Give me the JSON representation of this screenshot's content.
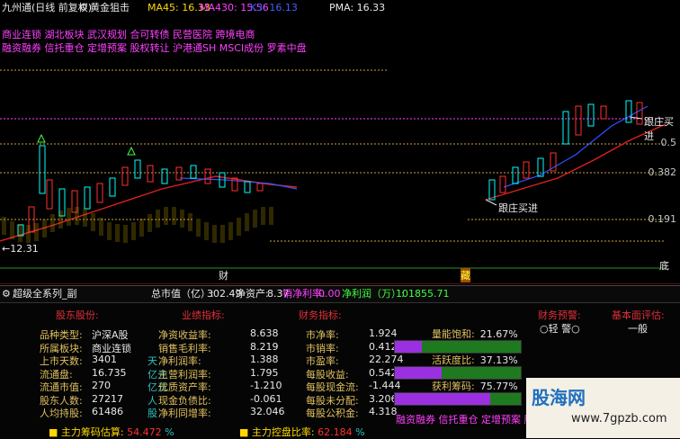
{
  "header": {
    "title": "九州通(日线 前复权)",
    "indicator": "黄金狙击",
    "ma5": "MA45: 16.33",
    "ma30": "MA430: 15.56",
    "ma_extra": "K3: 16.13",
    "pma": "PMA: 16.33"
  },
  "concepts": {
    "line1": "商业连锁 湖北板块 武汉规划 合可转债 民营医院 跨境电商",
    "line2": "融资融券 信托重仓 定增预案 股权转让 沪港通SH MSCI成份 罗素中盘"
  },
  "chart_annotations": {
    "low_price": "←12.31",
    "follow_1": "跟庄买进",
    "follow_2": "跟庄买进",
    "bottom_left_marker": "财",
    "bottom_mid_marker": "藏",
    "bottom_right_marker": "底"
  },
  "right_axis": {
    "r1": "0.5",
    "r2": "0.382",
    "r3": "0.191"
  },
  "sub_header": {
    "name": "超级全系列_副",
    "total_label": "总市值（亿）:",
    "total_value": "302.49",
    "net_asset_label": "净资产:",
    "net_asset_value": "8.37",
    "profit_rate_label": "销净利率:",
    "profit_rate_value": "0.00",
    "net_profit_label": "净利润（万）:",
    "net_profit_value": "101855.71"
  },
  "panel": {
    "col1_title": "股东股份:",
    "col2_title": "业绩指标:",
    "col3_title": "财务指标:",
    "col4_title": "财务预警:",
    "col5_title": "基本面评估:",
    "warning_value": "○轻 警○",
    "eval_value": "一般",
    "col1": [
      {
        "label": "品种类型:",
        "value": "沪深A股",
        "unit": ""
      },
      {
        "label": "所属板块:",
        "value": "商业连锁",
        "unit": ""
      },
      {
        "label": "上市天数:",
        "value": "3401",
        "unit": "天"
      },
      {
        "label": "流通盘:",
        "value": "16.735",
        "unit": "亿元"
      },
      {
        "label": "流通市值:",
        "value": "270",
        "unit": "亿元"
      },
      {
        "label": "股东人数:",
        "value": "27217",
        "unit": "人"
      },
      {
        "label": "人均持股:",
        "value": "61486",
        "unit": "股"
      }
    ],
    "col2": [
      {
        "label": "净资收益率:",
        "value": "8.638"
      },
      {
        "label": "销售毛利率:",
        "value": "8.219"
      },
      {
        "label": "净利润率:",
        "value": "1.388"
      },
      {
        "label": "主营利润率:",
        "value": "1.795"
      },
      {
        "label": "优质资产率:",
        "value": "-1.210"
      },
      {
        "label": "现金负债比:",
        "value": "-0.061"
      },
      {
        "label": "净利同增率:",
        "value": "32.046"
      }
    ],
    "col3": [
      {
        "label": "市净率:",
        "value": "1.924"
      },
      {
        "label": "市销率:",
        "value": "0.412"
      },
      {
        "label": "市盈率:",
        "value": "22.274"
      },
      {
        "label": "每股收益:",
        "value": "0.542"
      },
      {
        "label": "每股现金流:",
        "value": "-1.444"
      },
      {
        "label": "每股未分配:",
        "value": "3.206"
      },
      {
        "label": "每股公积金:",
        "value": "4.318"
      }
    ],
    "bars": [
      {
        "label": "量能饱和:",
        "value": "21.67%",
        "fraction": 0.2167,
        "color": "#9b30e0"
      },
      {
        "label": "活跃度比:",
        "value": "37.13%",
        "fraction": 0.3713,
        "color": "#9b30e0"
      },
      {
        "label": "获利筹码:",
        "value": "75.77%",
        "fraction": 0.7577,
        "color": "#9b30e0"
      }
    ],
    "bottom_tags": "融资融券 信托重仓 定增预案 股权转让",
    "chip_est_label": "主力筹码估算:",
    "chip_est_value": "54.472",
    "chip_est_unit": "%",
    "control_label": "主力控盘比率:",
    "control_value": "62.184",
    "control_unit": "%"
  },
  "watermark": {
    "brand": "股海网",
    "url": "www.7gpzb.com"
  }
}
